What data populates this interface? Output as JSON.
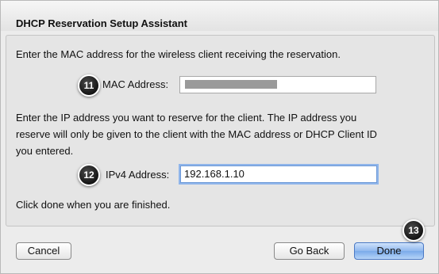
{
  "dialog": {
    "title": "DHCP Reservation Setup Assistant"
  },
  "mac_section": {
    "instruction": "Enter the MAC address for the wireless client receiving the reservation.",
    "badge": "11",
    "label": "MAC Address:",
    "value": ""
  },
  "ip_section": {
    "instruction_line1": "Enter the IP address you want to reserve for the client. The IP address you",
    "instruction_line2": "reserve will only be given to the client with the MAC address or DHCP Client ID",
    "instruction_line3": "you entered.",
    "badge": "12",
    "label": "IPv4 Address:",
    "value": "192.168.1.10"
  },
  "finish_text": "Click done when you are finished.",
  "buttons": {
    "cancel": "Cancel",
    "go_back": "Go Back",
    "done": "Done",
    "done_badge": "13"
  }
}
